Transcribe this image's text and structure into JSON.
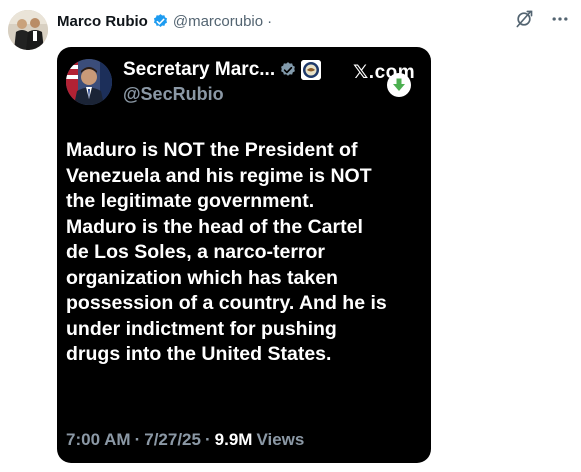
{
  "post": {
    "display_name": "Marco Rubio",
    "handle": "@marcorubio",
    "separator": "·"
  },
  "embedded": {
    "name": "Secretary Marc...",
    "handle": "@SecRubio",
    "source": "𝕏.com",
    "text": "Maduro is NOT the President of\nVenezuela and his regime is NOT\nthe legitimate government.\nMaduro is the head of the Cartel\nde Los Soles, a narco-terror\norganization which has taken\npossession of a country.  And he is\nunder indictment for pushing\ndrugs into the United States.",
    "time": "7:00 AM",
    "dot1": "·",
    "date": "7/27/25",
    "dot2": "·",
    "views_count": "9.9M",
    "views_label": "Views"
  },
  "icons": {
    "verified": "verified-badge-icon",
    "grok": "grok-icon",
    "more": "more-icon",
    "seal": "state-department-seal-icon",
    "download": "download-arrow-icon"
  },
  "colors": {
    "verified_blue": "#1d9bf0",
    "card_bg": "#000000",
    "muted_text": "#8b98a5",
    "download_green": "#4caf50"
  }
}
